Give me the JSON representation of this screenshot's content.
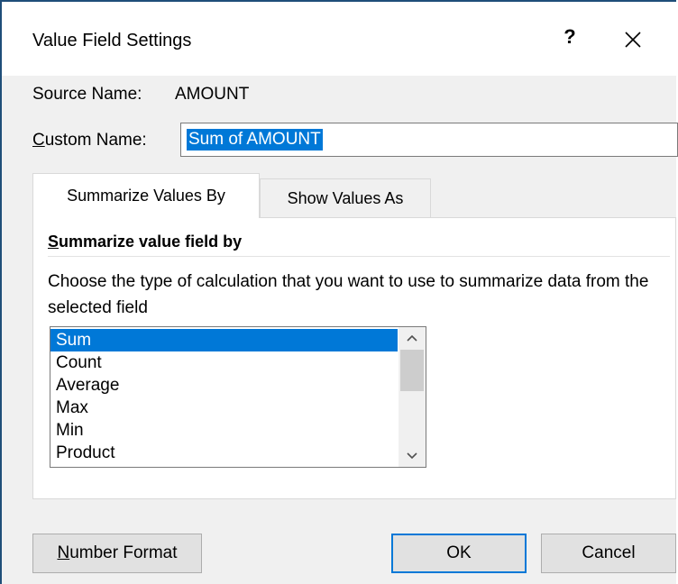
{
  "window": {
    "title": "Value Field Settings",
    "help_label": "?",
    "close_icon": "close-icon"
  },
  "source": {
    "label": "Source Name:",
    "value": "AMOUNT"
  },
  "custom_name": {
    "label_underlined": "C",
    "label_rest": "ustom Name:",
    "value": "Sum of AMOUNT"
  },
  "tabs": [
    {
      "label": "Summarize Values By",
      "active": true
    },
    {
      "label": "Show Values As",
      "active": false
    }
  ],
  "summarize": {
    "section_underlined": "S",
    "section_rest": "ummarize value field by",
    "description": "Choose the type of calculation that you want to use to summarize data from the selected field",
    "selected": "Sum",
    "items": [
      "Sum",
      "Count",
      "Average",
      "Max",
      "Min",
      "Product"
    ]
  },
  "buttons": {
    "number_format_underlined": "N",
    "number_format_rest": "umber Format",
    "ok": "OK",
    "cancel": "Cancel"
  },
  "colors": {
    "selection": "#0078d7",
    "dialog_bg": "#f0f0f0",
    "title_bg": "#ffffff",
    "window_border": "#1f4e79"
  }
}
